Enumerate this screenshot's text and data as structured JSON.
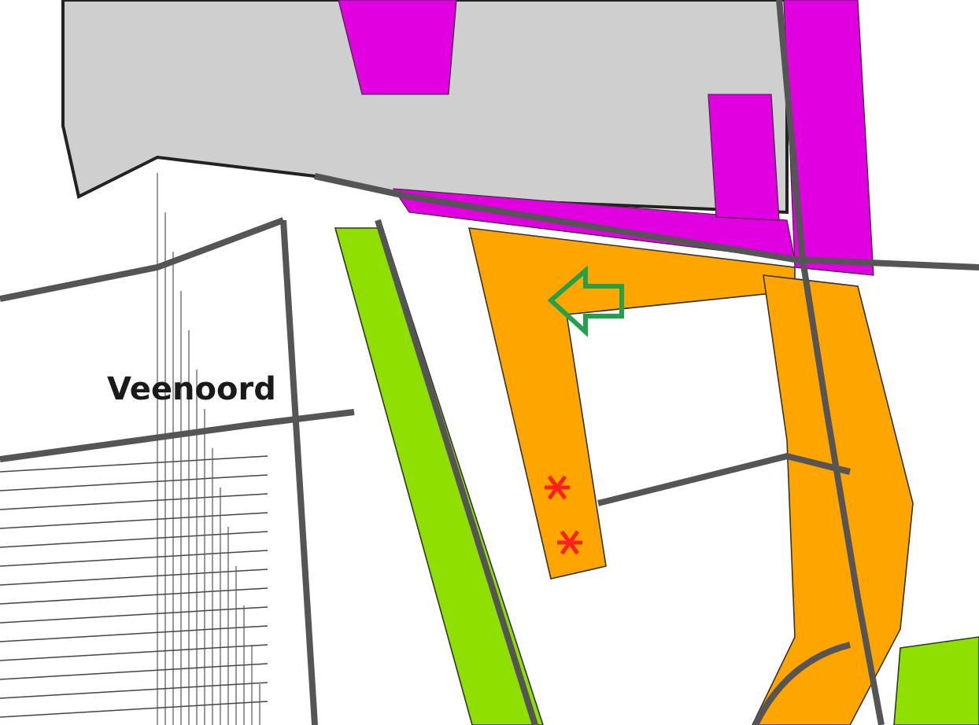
{
  "map": {
    "place_label": "Veenoord"
  }
}
